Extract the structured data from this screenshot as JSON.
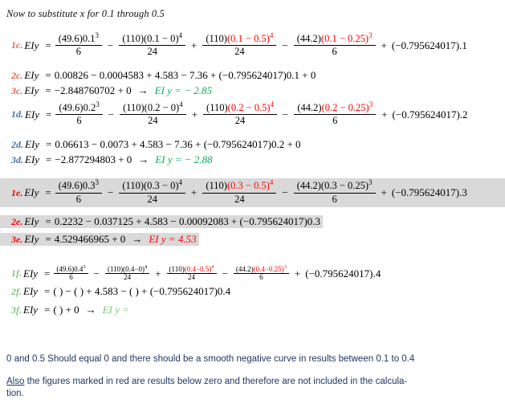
{
  "document": {
    "intro": "Now to substitute x for 0.1 through 0.5",
    "lhs": "EIy",
    "equals": "=",
    "arrow": "→",
    "constant_term": "(−0.795624017)"
  },
  "blocks": [
    {
      "id": "c",
      "x": "0.1",
      "label_color": "#e8604c",
      "highlighted": false,
      "expanded": {
        "label": "1c.",
        "t1_num": "(49.6)0.1",
        "t1_num_sup": "3",
        "t1_den": "6",
        "op1": "−",
        "t2_num": "(110)(0.1 − 0)",
        "t2_num_sup": "4",
        "t2_den": "24",
        "op2": "+",
        "t3_num_black": "(110)",
        "t3_num_red": "(0.1 − 0.5)",
        "t3_num_red_sup": "4",
        "t3_red": true,
        "t3_den": "24",
        "op3": "−",
        "t4_num_black": "(44.2)",
        "t4_num_red": "(0.1 − 0.25)",
        "t4_num_red_sup": "3",
        "t4_red": true,
        "t4_den": "6",
        "op4": "+",
        "tail": "(−0.795624017).1"
      },
      "numeric": {
        "label": "2c.",
        "text": "0.00826 −  0.0004583 + 4.583 − 7.36 + (−0.795624017)0.1 + 0"
      },
      "result": {
        "label": "3c.",
        "text": "−2.848760702 + 0",
        "answer": "EI y = − 2.85",
        "answer_color": "#0bab5b"
      }
    },
    {
      "id": "d",
      "x": "0.2",
      "label_color": "#4472a8",
      "highlighted": false,
      "expanded": {
        "label": "1d.",
        "t1_num": "(49.6)0.2",
        "t1_num_sup": "3",
        "t1_den": "6",
        "op1": "−",
        "t2_num": "(110)(0.2 − 0)",
        "t2_num_sup": "4",
        "t2_den": "24",
        "op2": "+",
        "t3_num_black": "(110)",
        "t3_num_red": "(0.2 − 0.5)",
        "t3_num_red_sup": "4",
        "t3_red": true,
        "t3_den": "24",
        "op3": "−",
        "t4_num_black": "(44.2)",
        "t4_num_red": "(0.2 − 0.25)",
        "t4_num_red_sup": "3",
        "t4_red": true,
        "t4_den": "6",
        "op4": "+",
        "tail": "(−0.795624017).2"
      },
      "numeric": {
        "label": "2d.",
        "text": "0.06613 −  0.0073 + 4.583 − 7.36 + (−0.795624017)0.2 + 0"
      },
      "result": {
        "label": "3d.",
        "text": "−2.877294803 + 0",
        "answer": "EI y = − 2.88",
        "answer_color": "#0bab5b"
      }
    },
    {
      "id": "e",
      "x": "0.3",
      "label_color": "#ff0000",
      "highlighted": true,
      "expanded": {
        "label": "1e.",
        "t1_num": "(49.6)0.3",
        "t1_num_sup": "3",
        "t1_den": "6",
        "op1": "−",
        "t2_num": "(110)(0.3 − 0)",
        "t2_num_sup": "4",
        "t2_den": "24",
        "op2": "+",
        "t3_num_black": "(110)",
        "t3_num_red": "(0.3 − 0.5)",
        "t3_num_red_sup": "4",
        "t3_red": true,
        "t3_den": "24",
        "op3": "−",
        "t4_num_black": "(44.2)(0.3 − 0.25)",
        "t4_num_red": "",
        "t4_num_red_sup": "3",
        "t4_red": false,
        "t4_den": "6",
        "op4": "+",
        "tail": "(−0.795624017).3"
      },
      "numeric": {
        "label": "2e.",
        "text": "0.2232 −  0.037125 + 4.583 − 0.00092083 + (−0.795624017)0.3"
      },
      "result": {
        "label": "3e.",
        "text": "4.529466965 + 0",
        "answer": "EI y = 4.53",
        "answer_color": "#ff0000"
      }
    },
    {
      "id": "f",
      "x": "0.4",
      "label_color": "#7fc47f",
      "highlighted": false,
      "small": true,
      "expanded": {
        "label": "1f.",
        "t1_num": "(49.6)0.4",
        "t1_num_sup": "3",
        "t1_den": "6",
        "op1": "−",
        "t2_num": "(110)(0.4−0)",
        "t2_num_sup": "4",
        "t2_den": "24",
        "op2": "+",
        "t3_num_black": "(110)",
        "t3_num_red": "(0.4−0.5)",
        "t3_num_red_sup": "4",
        "t3_red": true,
        "t3_den": "24",
        "op3": "−",
        "t4_num_black": "(44.2)",
        "t4_num_red": "(0.4−0.25)",
        "t4_num_red_sup": "3",
        "t4_red": true,
        "t4_den": "6",
        "op4": "+",
        "tail": "(−0.795624017).4"
      },
      "numeric": {
        "label": "2f.",
        "text": "( ) − ( ) + 4.583 − ( ) + (−0.795624017)0.4"
      },
      "result": {
        "label": "3f.",
        "text": "( ) + 0",
        "answer": "EI y =",
        "answer_color": "#7fc47f"
      }
    }
  ],
  "notes": {
    "line1": "0 and 0.5 Should equal 0 and there should be a smooth negative curve in results between 0.1 to 0.4",
    "line2_underlined": "Also",
    "line2_rest": " the figures marked in red are results below zero and therefore are not included in the calcula-",
    "line3": "tion."
  }
}
